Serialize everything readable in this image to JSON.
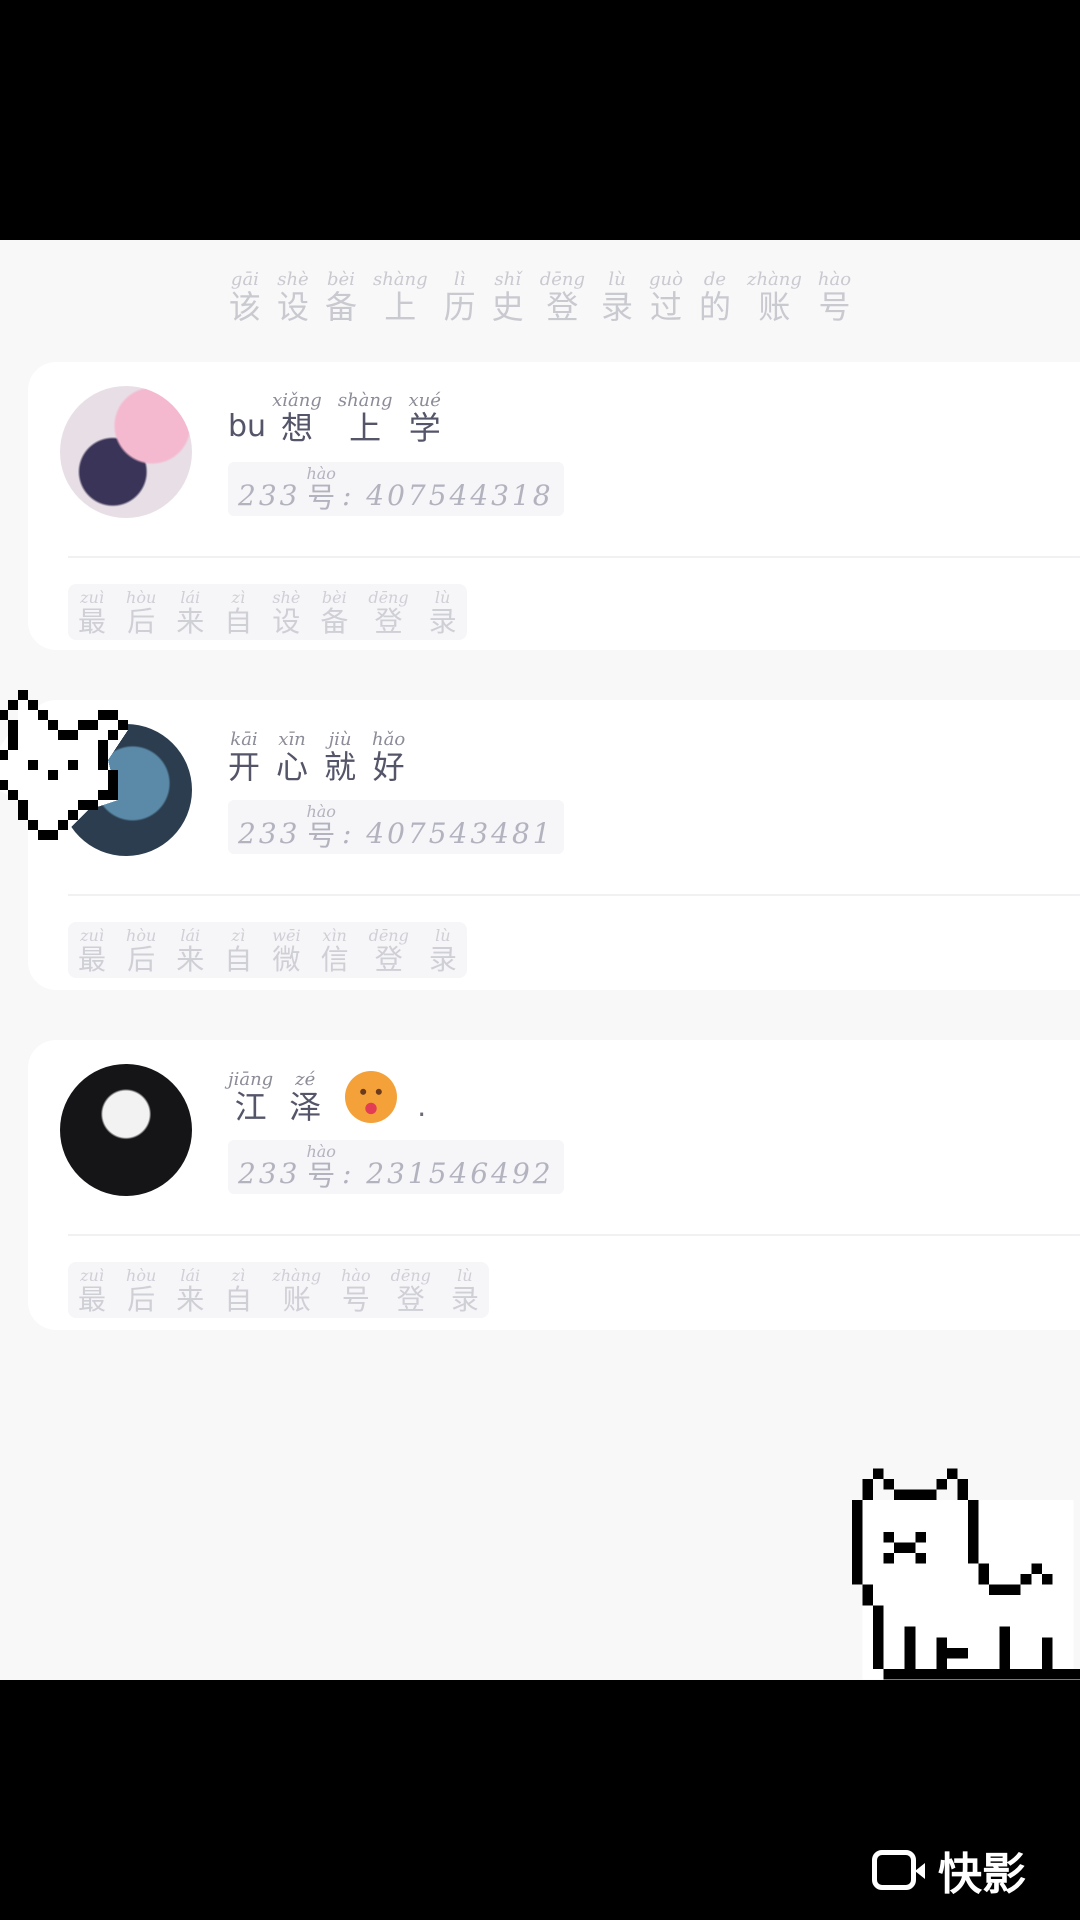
{
  "title": {
    "chars": [
      {
        "py": "gāi",
        "hz": "该"
      },
      {
        "py": "shè",
        "hz": "设"
      },
      {
        "py": "bèi",
        "hz": "备"
      },
      {
        "py": "shàng",
        "hz": "上"
      },
      {
        "py": "lì",
        "hz": "历"
      },
      {
        "py": "shǐ",
        "hz": "史"
      },
      {
        "py": "dēng",
        "hz": "登"
      },
      {
        "py": "lù",
        "hz": "录"
      },
      {
        "py": "guò",
        "hz": "过"
      },
      {
        "py": "de",
        "hz": "的"
      },
      {
        "py": "zhàng",
        "hz": "账"
      },
      {
        "py": "hào",
        "hz": "号"
      }
    ]
  },
  "accounts": [
    {
      "name_prefix": "bu",
      "name": [
        {
          "py": "xiǎng",
          "hz": "想"
        },
        {
          "py": "shàng",
          "hz": "上"
        },
        {
          "py": "xué",
          "hz": "学"
        }
      ],
      "uid_prefix": "233",
      "uid_label": {
        "py": "hào",
        "hz": "号"
      },
      "uid_value": ": 407544318",
      "footer": [
        {
          "py": "zuì",
          "hz": "最"
        },
        {
          "py": "hòu",
          "hz": "后"
        },
        {
          "py": "lái",
          "hz": "来"
        },
        {
          "py": "zì",
          "hz": "自"
        },
        {
          "py": "shè",
          "hz": "设"
        },
        {
          "py": "bèi",
          "hz": "备"
        },
        {
          "py": "dēng",
          "hz": "登"
        },
        {
          "py": "lù",
          "hz": "录"
        }
      ]
    },
    {
      "name": [
        {
          "py": "kāi",
          "hz": "开"
        },
        {
          "py": "xīn",
          "hz": "心"
        },
        {
          "py": "jiù",
          "hz": "就"
        },
        {
          "py": "hǎo",
          "hz": "好"
        }
      ],
      "uid_prefix": "233",
      "uid_label": {
        "py": "hào",
        "hz": "号"
      },
      "uid_value": ": 407543481",
      "footer": [
        {
          "py": "zuì",
          "hz": "最"
        },
        {
          "py": "hòu",
          "hz": "后"
        },
        {
          "py": "lái",
          "hz": "来"
        },
        {
          "py": "zì",
          "hz": "自"
        },
        {
          "py": "wēi",
          "hz": "微"
        },
        {
          "py": "xìn",
          "hz": "信"
        },
        {
          "py": "dēng",
          "hz": "登"
        },
        {
          "py": "lù",
          "hz": "录"
        }
      ]
    },
    {
      "name": [
        {
          "py": "jiāng",
          "hz": "江"
        },
        {
          "py": "zé",
          "hz": "泽"
        }
      ],
      "name_suffix": ".",
      "uid_prefix": "233",
      "uid_label": {
        "py": "hào",
        "hz": "号"
      },
      "uid_value": ": 231546492",
      "footer": [
        {
          "py": "zuì",
          "hz": "最"
        },
        {
          "py": "hòu",
          "hz": "后"
        },
        {
          "py": "lái",
          "hz": "来"
        },
        {
          "py": "zì",
          "hz": "自"
        },
        {
          "py": "zhàng",
          "hz": "账"
        },
        {
          "py": "hào",
          "hz": "号"
        },
        {
          "py": "dēng",
          "hz": "登"
        },
        {
          "py": "lù",
          "hz": "录"
        }
      ]
    }
  ],
  "watermark": {
    "text": "快影"
  }
}
